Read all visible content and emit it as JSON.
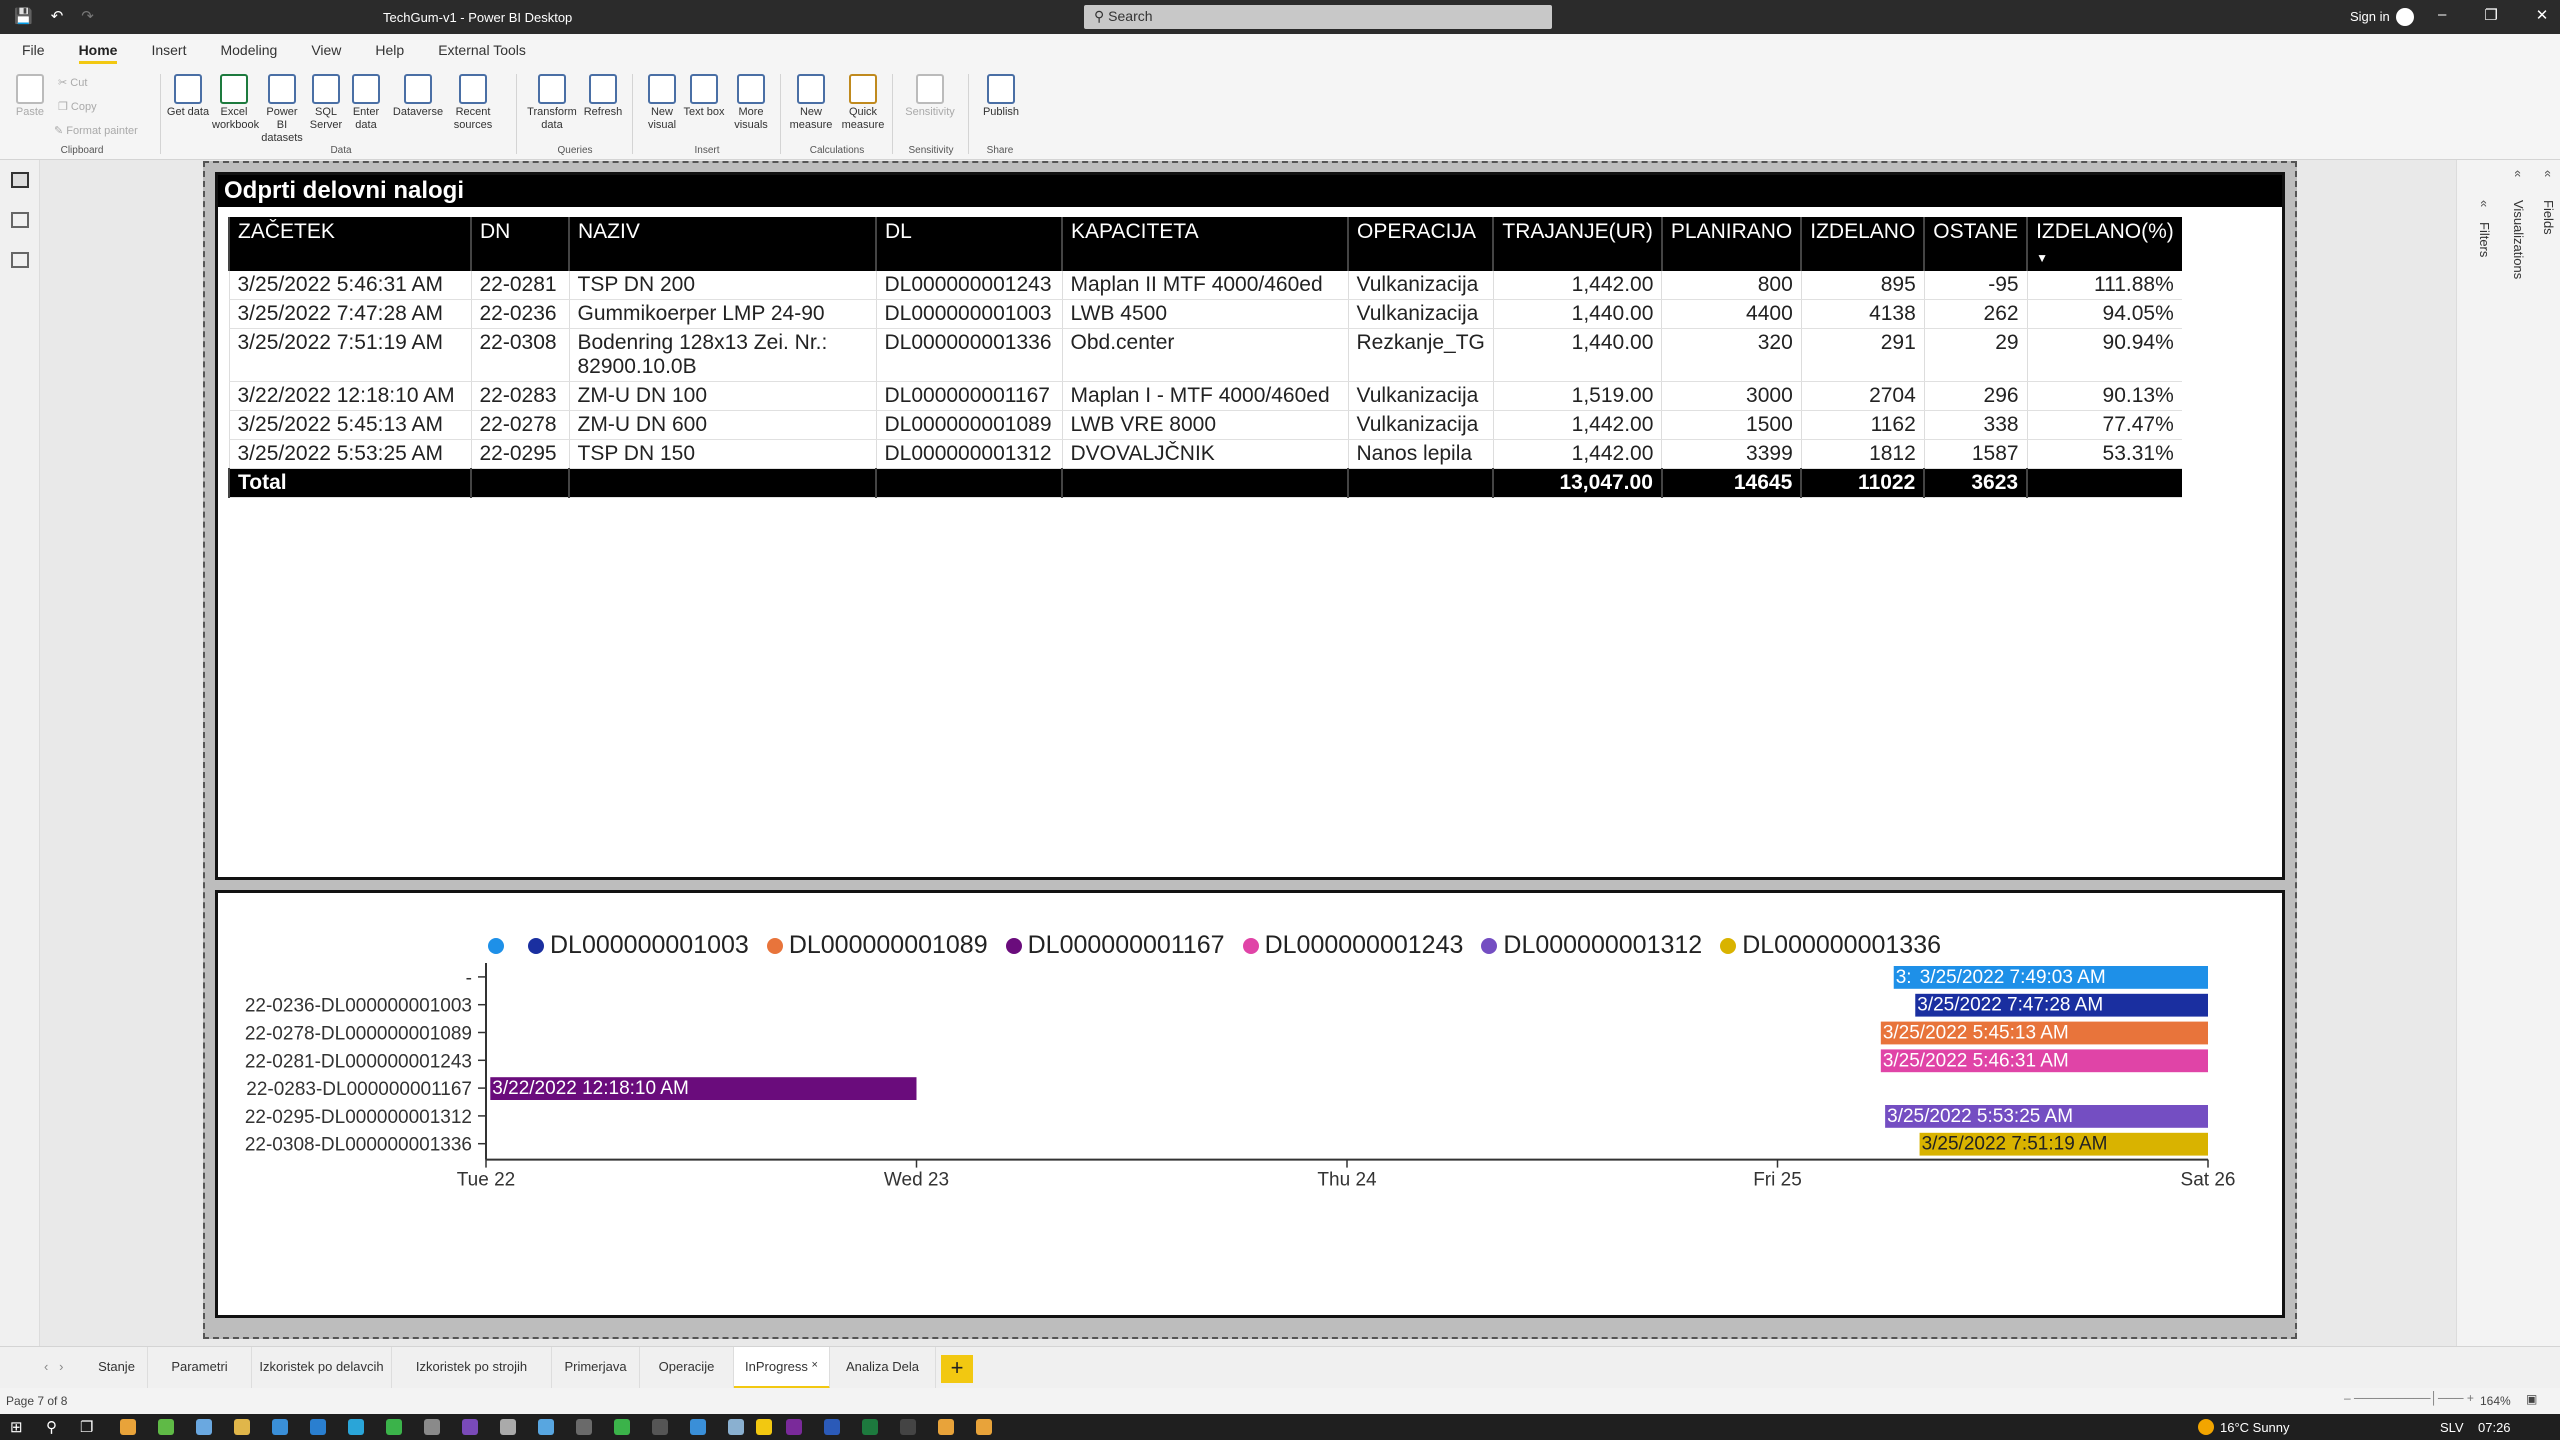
{
  "window": {
    "title": "TechGum-v1 - Power BI Desktop",
    "search_placeholder": "Search",
    "sign_in": "Sign in"
  },
  "ribbon": {
    "tabs": [
      "File",
      "Home",
      "Insert",
      "Modeling",
      "View",
      "Help",
      "External Tools"
    ],
    "active_tab": "Home",
    "clipboard": {
      "paste": "Paste",
      "cut": "Cut",
      "copy": "Copy",
      "format_painter": "Format painter",
      "label": "Clipboard"
    },
    "data": {
      "get_data": "Get data",
      "excel": "Excel workbook",
      "pbi_datasets": "Power BI datasets",
      "sql": "SQL Server",
      "enter_data": "Enter data",
      "dataverse": "Dataverse",
      "recent": "Recent sources",
      "label": "Data"
    },
    "queries": {
      "transform": "Transform data",
      "refresh": "Refresh",
      "label": "Queries"
    },
    "insert": {
      "new_visual": "New visual",
      "text_box": "Text box",
      "more_visuals": "More visuals",
      "label": "Insert"
    },
    "calculations": {
      "new_measure": "New measure",
      "quick_measure": "Quick measure",
      "label": "Calculations"
    },
    "sensitivity": {
      "btn": "Sensitivity",
      "label": "Sensitivity"
    },
    "share": {
      "publish": "Publish",
      "label": "Share"
    }
  },
  "right_panel": {
    "filters": "Filters",
    "visualizations": "Visualizations",
    "fields": "Fields"
  },
  "table_visual": {
    "title": "Odprti delovni nalogi",
    "columns": [
      "ZAČETEK",
      "DN",
      "NAZIV",
      "DL",
      "KAPACITETA",
      "OPERACIJA",
      "TRAJANJE(UR)",
      "PLANIRANO",
      "IZDELANO",
      "OSTANE",
      "IZDELANO(%)"
    ],
    "rows": [
      [
        "3/25/2022 5:46:31 AM",
        "22-0281",
        "TSP DN 200",
        "DL000000001243",
        "Maplan II MTF 4000/460ed",
        "Vulkanizacija",
        "1,442.00",
        "800",
        "895",
        "-95",
        "111.88%"
      ],
      [
        "3/25/2022 7:47:28 AM",
        "22-0236",
        "Gummikoerper LMP 24-90",
        "DL000000001003",
        "LWB 4500",
        "Vulkanizacija",
        "1,440.00",
        "4400",
        "4138",
        "262",
        "94.05%"
      ],
      [
        "3/25/2022 7:51:19 AM",
        "22-0308",
        "Bodenring 128x13 Zei. Nr.: 82900.10.0B",
        "DL000000001336",
        "Obd.center",
        "Rezkanje_TG",
        "1,440.00",
        "320",
        "291",
        "29",
        "90.94%"
      ],
      [
        "3/22/2022 12:18:10 AM",
        "22-0283",
        "ZM-U DN 100",
        "DL000000001167",
        "Maplan I - MTF 4000/460ed",
        "Vulkanizacija",
        "1,519.00",
        "3000",
        "2704",
        "296",
        "90.13%"
      ],
      [
        "3/25/2022 5:45:13 AM",
        "22-0278",
        "ZM-U DN 600",
        "DL000000001089",
        "LWB VRE 8000",
        "Vulkanizacija",
        "1,442.00",
        "1500",
        "1162",
        "338",
        "77.47%"
      ],
      [
        "3/25/2022 5:53:25 AM",
        "22-0295",
        "TSP DN 150",
        "DL000000001312",
        "DVOVALJČNIK",
        "Nanos lepila",
        "1,442.00",
        "3399",
        "1812",
        "1587",
        "53.31%"
      ]
    ],
    "total": [
      "Total",
      "",
      "",
      "",
      "",
      "",
      "13,047.00",
      "14645",
      "11022",
      "3623",
      ""
    ]
  },
  "chart_data": {
    "type": "gantt",
    "legend": [
      {
        "name": "",
        "color": "#1e90e8"
      },
      {
        "name": "DL000000001003",
        "color": "#1a2fa0"
      },
      {
        "name": "DL000000001089",
        "color": "#e8743b"
      },
      {
        "name": "DL000000001167",
        "color": "#6a0c7c"
      },
      {
        "name": "DL000000001243",
        "color": "#e044a7"
      },
      {
        "name": "DL000000001312",
        "color": "#744ec2"
      },
      {
        "name": "DL000000001336",
        "color": "#d9b300"
      }
    ],
    "categories": [
      "-",
      "22-0236-DL000000001003",
      "22-0278-DL000000001089",
      "22-0281-DL000000001243",
      "22-0283-DL000000001167",
      "22-0295-DL000000001312",
      "22-0308-DL000000001336"
    ],
    "x_ticks": [
      "Tue 22",
      "Wed 23",
      "Thu 24",
      "Fri 25",
      "Sat 26"
    ],
    "x_range_days": [
      22,
      26
    ],
    "bars": [
      {
        "row": 0,
        "start": 25.27,
        "end": 26.0,
        "label": "3/25/2022 7:49:03 AM",
        "prefix": "3:",
        "color": "#1e90e8"
      },
      {
        "row": 1,
        "start": 25.32,
        "end": 26.0,
        "label": "3/25/2022 7:47:28 AM",
        "color": "#1a2fa0"
      },
      {
        "row": 2,
        "start": 25.24,
        "end": 26.0,
        "label": "3/25/2022 5:45:13 AM",
        "color": "#e8743b"
      },
      {
        "row": 3,
        "start": 25.24,
        "end": 26.0,
        "label": "3/25/2022 5:46:31 AM",
        "color": "#e044a7"
      },
      {
        "row": 4,
        "start": 22.01,
        "end": 23.0,
        "label": "3/22/2022 12:18:10 AM",
        "color": "#6a0c7c"
      },
      {
        "row": 5,
        "start": 25.25,
        "end": 26.0,
        "label": "3/25/2022 5:53:25 AM",
        "color": "#744ec2"
      },
      {
        "row": 6,
        "start": 25.33,
        "end": 26.0,
        "label": "3/25/2022 7:51:19 AM",
        "color": "#d9b300"
      }
    ]
  },
  "page_tabs": {
    "tabs": [
      "Stanje",
      "Parametri",
      "Izkoristek po delavcih",
      "Izkoristek po strojih",
      "Primerjava",
      "Operacije",
      "InProgress",
      "Analiza Dela"
    ],
    "active": "InProgress",
    "add": "+"
  },
  "status": {
    "page": "Page 7 of 8",
    "zoom": "164%"
  },
  "taskbar": {
    "weather": "16°C Sunny",
    "lang": "SLV",
    "time": "07:26"
  }
}
